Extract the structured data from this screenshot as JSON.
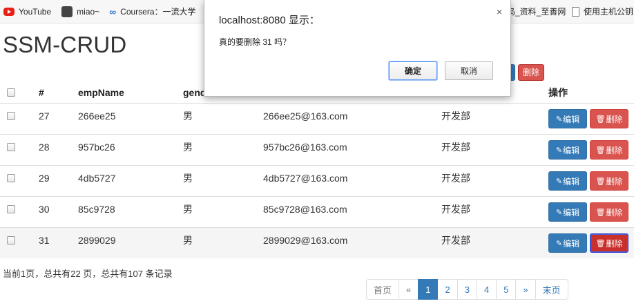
{
  "bookmarks": [
    {
      "label": "YouTube",
      "icon": "youtube-icon"
    },
    {
      "label": "miao~",
      "icon": "miao-icon"
    },
    {
      "label": "Coursera：一流大学",
      "icon": "coursera-icon"
    },
    {
      "label": "鸟_资料_至善网",
      "icon": ""
    },
    {
      "label": "使用主机公钥",
      "icon": "document-icon"
    }
  ],
  "page": {
    "title": "SSM-CRUD",
    "top_delete_label": "删除"
  },
  "table": {
    "headers": {
      "id": "#",
      "name": "empName",
      "gender": "gend",
      "ops": "操作"
    },
    "rows": [
      {
        "id": "27",
        "name": "266ee25",
        "gender": "男",
        "email": "266ee25@163.com",
        "dept": "开发部"
      },
      {
        "id": "28",
        "name": "957bc26",
        "gender": "男",
        "email": "957bc26@163.com",
        "dept": "开发部"
      },
      {
        "id": "29",
        "name": "4db5727",
        "gender": "男",
        "email": "4db5727@163.com",
        "dept": "开发部"
      },
      {
        "id": "30",
        "name": "85c9728",
        "gender": "男",
        "email": "85c9728@163.com",
        "dept": "开发部"
      },
      {
        "id": "31",
        "name": "2899029",
        "gender": "男",
        "email": "2899029@163.com",
        "dept": "开发部"
      }
    ],
    "edit_label": "编辑",
    "delete_label": "删除"
  },
  "footer": {
    "info": "当前1页，总共有22 页，总共有107 条记录",
    "pager": [
      "首页",
      "«",
      "1",
      "2",
      "3",
      "4",
      "5",
      "»",
      "末页"
    ],
    "active_page": "1"
  },
  "dialog": {
    "title": "localhost:8080 显示：",
    "message": "真的要删除 31 吗？",
    "ok_label": "确定",
    "cancel_label": "取消",
    "close_glyph": "×"
  },
  "colors": {
    "primary": "#337ab7",
    "danger": "#d9534f"
  }
}
